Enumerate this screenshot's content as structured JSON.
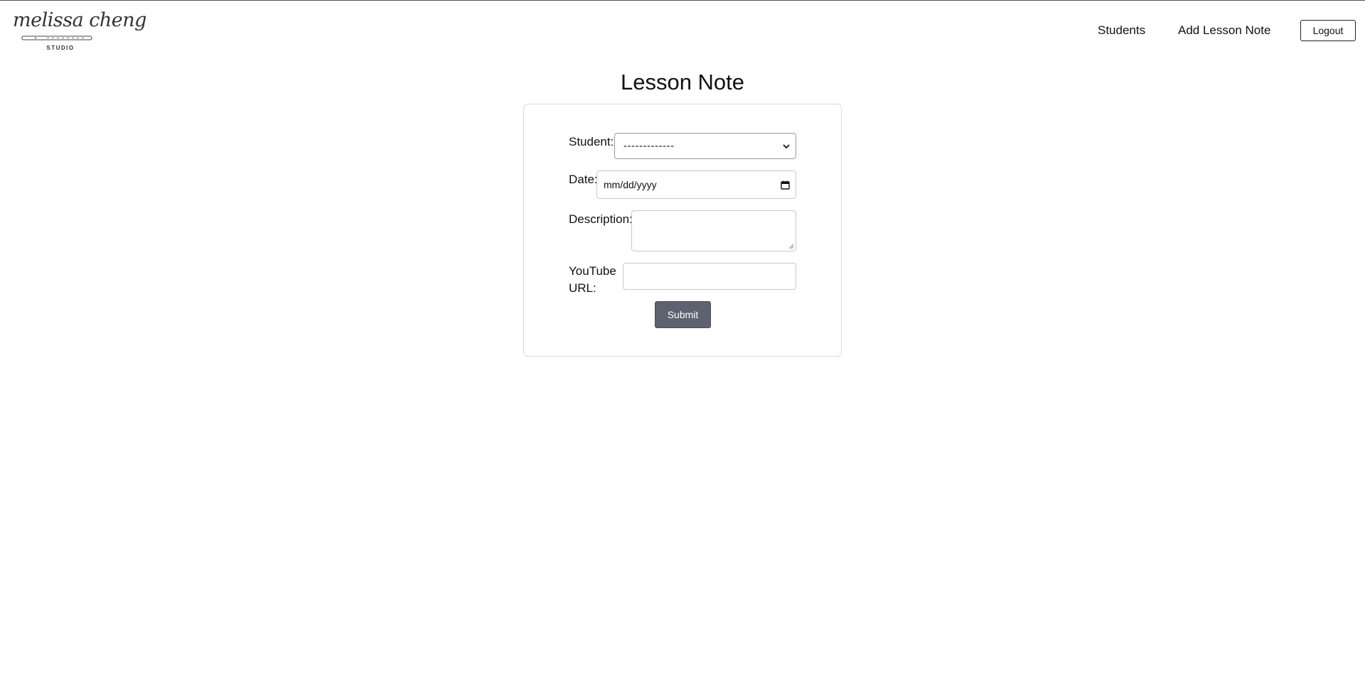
{
  "brand": {
    "logo_script": "melissa cheng",
    "logo_sub": "STUDIO"
  },
  "nav": {
    "students_label": "Students",
    "add_lesson_label": "Add Lesson Note",
    "logout_label": "Logout"
  },
  "page": {
    "title": "Lesson Note"
  },
  "form": {
    "student_label": "Student:",
    "student_value": "-------------",
    "date_label": "Date:",
    "date_placeholder": "mm/dd/yyyy",
    "description_label": "Description:",
    "description_value": "",
    "youtube_label_line1": "YouTube",
    "youtube_label_line2": "URL:",
    "youtube_value": "",
    "submit_label": "Submit"
  },
  "colors": {
    "submit_bg": "#5c6270",
    "text": "#111111"
  }
}
